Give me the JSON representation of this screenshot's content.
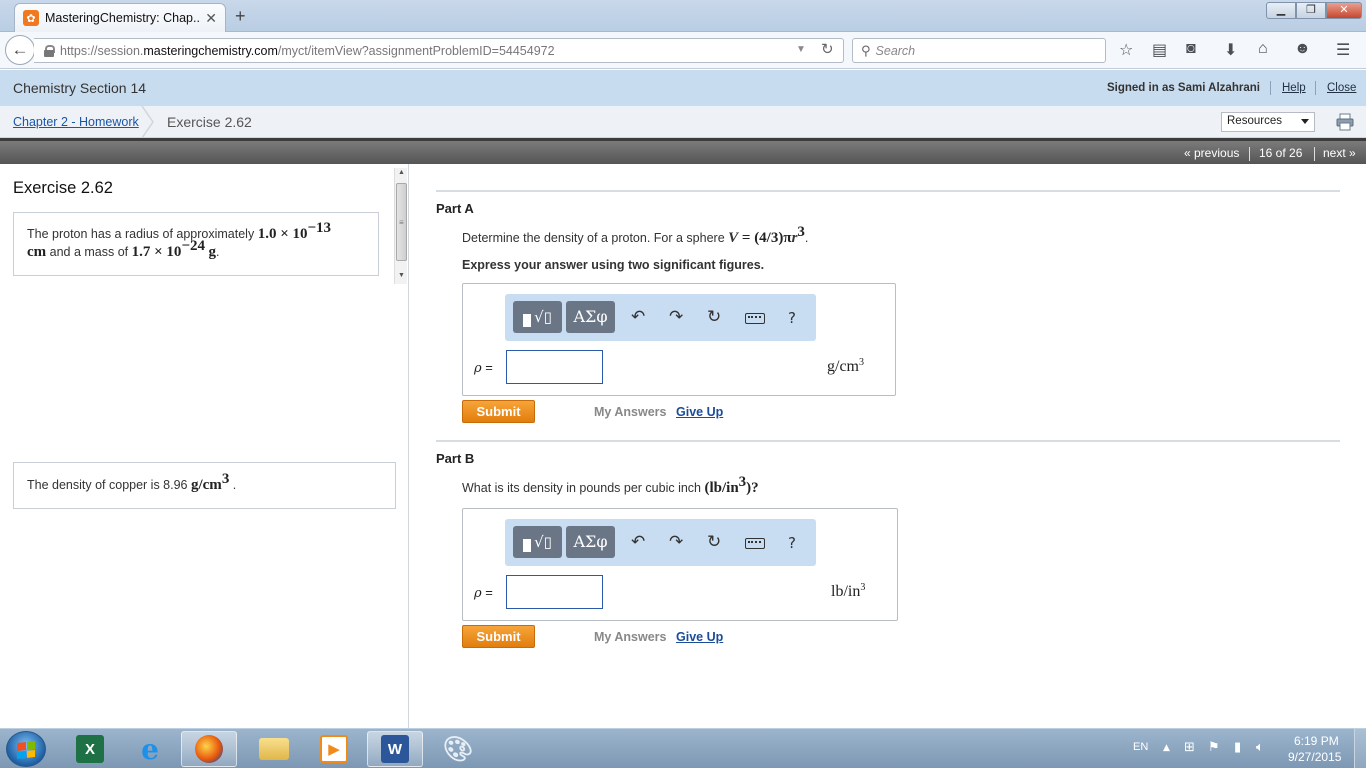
{
  "browser": {
    "tab_title": "MasteringChemistry: Chap...",
    "tab_close": "✕",
    "new_tab": "+",
    "window_controls": {
      "minimize": "▁",
      "maximize": "❐",
      "close": "✕"
    },
    "url_prefix": "https://session.",
    "url_host": "masteringchemistry.com",
    "url_path": "/myct/itemView?assignmentProblemID=54454972",
    "search_placeholder": "Search",
    "toolbar_icons": [
      "bookmark-star-icon",
      "reading-list-icon",
      "pocket-icon",
      "download-icon",
      "home-icon",
      "hello-icon",
      "menu-icon"
    ]
  },
  "header": {
    "course_title": "Chemistry Section 14",
    "signed_in": "Signed in as Sami Alzahrani",
    "help": "Help",
    "close": "Close"
  },
  "breadcrumb": {
    "assignment": "Chapter 2 - Homework",
    "current": "Exercise 2.62",
    "resources": "Resources"
  },
  "pager": {
    "previous": "« previous",
    "count": "16 of 26",
    "next": "next »"
  },
  "left": {
    "title": "Exercise 2.62",
    "problem_text_1": "The proton has a radius of approximately ",
    "radius_value": "1.0 × 10",
    "radius_exp": "−13",
    "radius_unit": "cm",
    "problem_text_2": " and a mass of ",
    "mass_value": "1.7 × 10",
    "mass_exp": "−24",
    "mass_unit": "g",
    "copper_text": "The density of copper is 8.96 ",
    "copper_unit": "g/cm",
    "copper_exp": "3",
    "period": "."
  },
  "partA": {
    "title": "Part A",
    "question": "Determine the density of a proton. For a sphere ",
    "formula_v": "V",
    "formula_eq": " = (4/3)π",
    "formula_r": "r",
    "formula_exp": "3",
    "instruction": "Express your answer using two significant figures.",
    "label": "ρ",
    "eq": " =",
    "unit": "g/cm",
    "unit_exp": "3",
    "submit": "Submit",
    "my_answers": "My Answers",
    "give_up": "Give Up"
  },
  "partB": {
    "title": "Part B",
    "question": "What is its density in pounds per cubic inch ",
    "unit_paren": "(lb/in",
    "unit_paren_exp": "3",
    "question_end": ")?",
    "label": "ρ",
    "eq": " =",
    "unit": "lb/in",
    "unit_exp": "3",
    "submit": "Submit",
    "my_answers": "My Answers",
    "give_up": "Give Up"
  },
  "math_toolbar": {
    "greek": "ΑΣφ",
    "undo": "↶",
    "redo": "↷",
    "reset": "↻",
    "help": "?"
  },
  "taskbar": {
    "apps": [
      "excel",
      "internet-explorer",
      "firefox",
      "file-explorer",
      "media-player",
      "word",
      "paint"
    ],
    "language": "EN",
    "time": "6:19 PM",
    "date": "9/27/2015"
  },
  "colors": {
    "header_bg": "#c8dcef",
    "submit_orange": "#e8870f",
    "link_blue": "#1a56a8",
    "toolbar_blue": "#c8dcf2"
  }
}
